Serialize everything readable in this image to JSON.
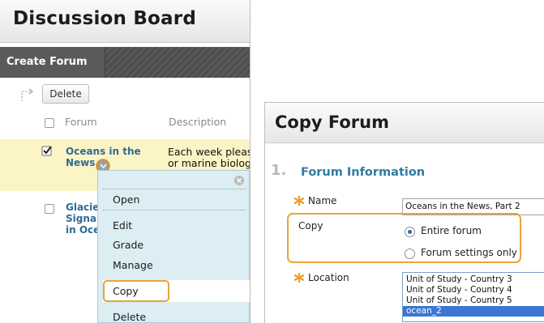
{
  "discussion_board": {
    "title": "Discussion Board",
    "create_forum_label": "Create Forum",
    "delete_label": "Delete",
    "columns": {
      "forum": "Forum",
      "description": "Description"
    },
    "rows": [
      {
        "forum_lines": [
          "Oceans in the",
          "News"
        ],
        "description_lines": [
          "Each week pleas",
          "or marine biolog"
        ],
        "checked": true
      },
      {
        "forum_lines": [
          "Glacier",
          "Signal",
          "in Oce"
        ],
        "description_lines": [],
        "checked": false
      }
    ],
    "context_menu": {
      "items": [
        "Open",
        "Edit",
        "Grade",
        "Manage",
        "Copy",
        "Delete"
      ]
    }
  },
  "copy_forum": {
    "title": "Copy Forum",
    "step_number": "1.",
    "section_title": "Forum Information",
    "name_label": "Name",
    "name_value": "Oceans in the News, Part 2",
    "copy_label": "Copy",
    "copy_options": [
      "Entire forum",
      "Forum settings only"
    ],
    "copy_selected": "Entire forum",
    "location_label": "Location",
    "location_options": [
      "Unit of Study - Country 3",
      "Unit of Study - Country 4",
      "Unit of Study - Country 5",
      "ocean_2"
    ],
    "location_selected": "ocean_2"
  },
  "colors": {
    "accent_highlight": "#e8a536",
    "link": "#2e6b96",
    "section_title": "#2f7ba2",
    "required_star": "#f0a030",
    "menu_background": "#dcedf3",
    "selected_row": "#fbf4c5",
    "selected_option": "#3b77d2"
  },
  "icons": [
    "corner-arrow-icon",
    "chevron-down-icon",
    "close-icon",
    "checkmark-icon",
    "required-asterisk-icon"
  ]
}
